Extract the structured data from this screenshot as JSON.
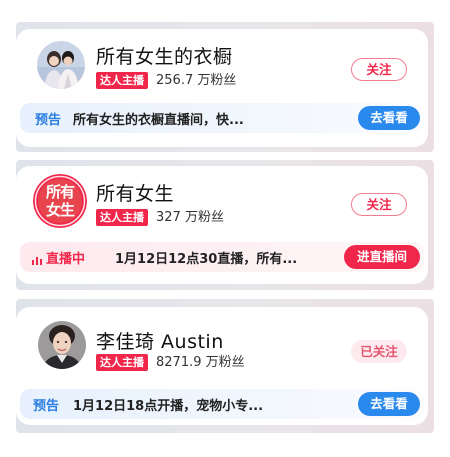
{
  "cards": [
    {
      "name": "所有女生的衣橱",
      "badge": "达人主播",
      "fans": "256.7 万粉丝",
      "follow_label": "关注",
      "sub_tag": "预告",
      "sub_text": "所有女生的衣橱直播间，快...",
      "sub_button": "去看看"
    },
    {
      "name": "所有女生",
      "avatar_text": "所有女生",
      "badge": "达人主播",
      "fans": "327 万粉丝",
      "follow_label": "关注",
      "sub_tag": "直播中",
      "sub_text": "1月12日12点30直播，所有...",
      "sub_button": "进直播间"
    },
    {
      "name": "李佳琦 Austin",
      "badge": "达人主播",
      "fans": "8271.9 万粉丝",
      "follow_label": "已关注",
      "sub_tag": "预告",
      "sub_text": "1月12日18点开播，宠物小专...",
      "sub_button": "去看看"
    }
  ],
  "colors": {
    "accent_red": "#f0274b",
    "accent_blue": "#2a89ec"
  }
}
